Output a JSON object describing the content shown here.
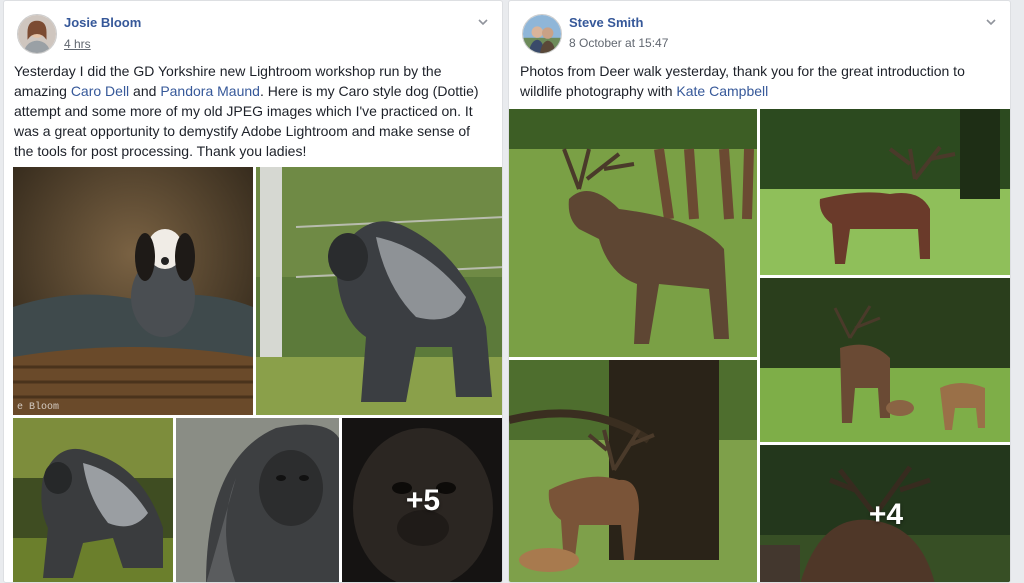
{
  "posts": [
    {
      "author": "Josie Bloom",
      "time": "4 hrs",
      "text_parts": {
        "p1": "Yesterday I did the GD Yorkshire new Lightroom workshop run by the amazing ",
        "link1": "Caro Dell",
        "p2": " and ",
        "link2": "Pandora Maund",
        "p3": ". Here is my Caro style dog (Dottie) attempt and some more of my old JPEG images which I've practiced on. It was a great opportunity to demystify Adobe Lightroom and make sense of the tools for post processing. Thank you ladies!"
      },
      "more_photos": "+5",
      "watermark": "e Bloom",
      "photo_alts": [
        "spaniel-on-wicker-bed",
        "gorilla-walking",
        "gorilla-sitting",
        "gorilla-portrait",
        "gorilla-closeup"
      ]
    },
    {
      "author": "Steve Smith",
      "time": "8 October at 15:47",
      "text_parts": {
        "p1": "Photos from Deer walk yesterday, thank you for the great introduction to wildlife photography with ",
        "link1": "Kate Campbell"
      },
      "more_photos": "+4",
      "photo_alts": [
        "stag-bellowing",
        "stag-in-field",
        "stag-under-tree",
        "stag-with-hinds",
        "stag-closeup"
      ]
    }
  ],
  "colors": {
    "link": "#365899",
    "meta": "#616770",
    "text": "#1d2129",
    "bg": "#e9ebee"
  },
  "icons": {
    "options": "chevron-down-icon"
  }
}
